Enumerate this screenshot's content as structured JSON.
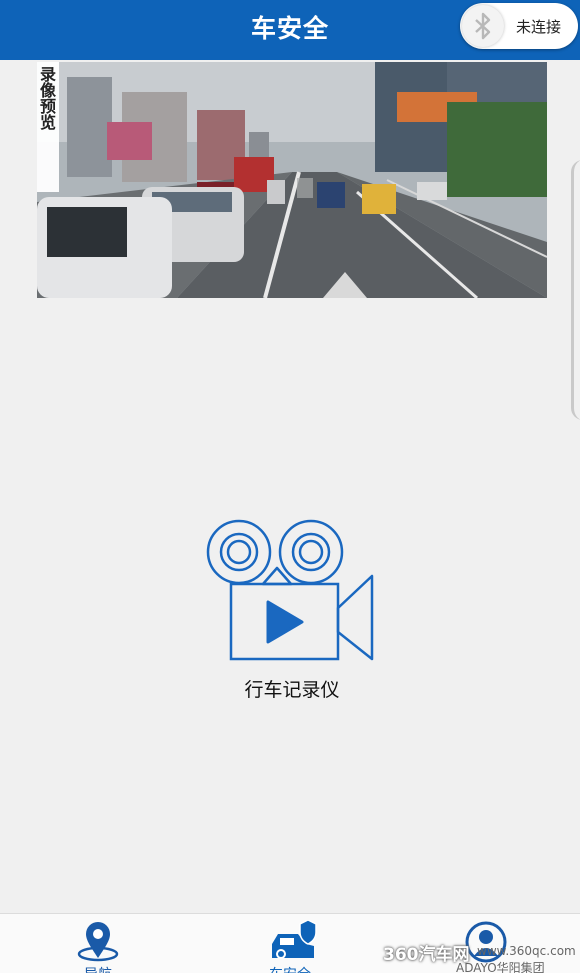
{
  "header": {
    "title": "车安全",
    "bluetooth_status": "未连接"
  },
  "preview": {
    "tag": "录像预览"
  },
  "recorder": {
    "label": "行车记录仪"
  },
  "nav": {
    "items": [
      {
        "label": "导航",
        "icon": "location-pin-icon"
      },
      {
        "label": "车安全",
        "icon": "car-safety-icon"
      },
      {
        "label": "",
        "icon": "user-icon"
      }
    ]
  },
  "watermark": {
    "brand": "360汽车网",
    "url": "www.360qc.com",
    "corp": "ADAYO华阳集团"
  },
  "colors": {
    "accent": "#0e63b8",
    "background": "#f0f0f0"
  }
}
